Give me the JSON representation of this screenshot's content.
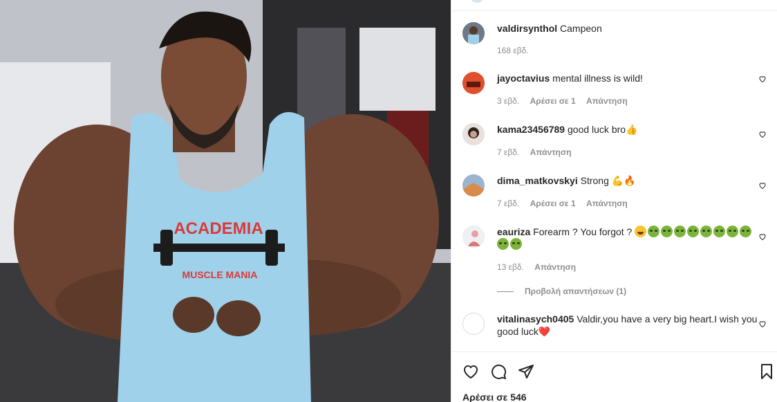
{
  "post": {
    "image_alt": "Bodybuilder with oversized arms wearing a light blue tank top",
    "shirt_text_top": "ACADEMIA",
    "shirt_text_bottom": "MUSCLE MANIA"
  },
  "caption": {
    "username": "valdirsynthol",
    "text": "Campeon",
    "time": "168 εβδ."
  },
  "comments": [
    {
      "username": "jayoctavius",
      "text": "mental illness is wild!",
      "time": "3 εβδ.",
      "likes": "Αρέσει σε 1",
      "reply": "Απάντηση"
    },
    {
      "username": "kama23456789",
      "text": "good luck bro👍",
      "time": "7 εβδ.",
      "reply": "Απάντηση"
    },
    {
      "username": "dima_matkovskyi",
      "text": "Strong 💪🔥",
      "time": "7 εβδ.",
      "likes": "Αρέσει σε 1",
      "reply": "Απάντηση"
    },
    {
      "username": "eauriza",
      "text": "Forearm ? You forgot ?",
      "time": "13 εβδ.",
      "reply": "Απάντηση"
    },
    {
      "username": "vitalinasych0405",
      "text": "Valdir,you have a very big heart.I wish you good luck❤️"
    }
  ],
  "view_replies": "Προβολή απαντήσεων (1)",
  "likes_total": "Αρέσει σε 546",
  "icons": {
    "like": "heart-icon",
    "comment": "comment-bubble-icon",
    "share": "paper-plane-icon",
    "save": "bookmark-icon"
  },
  "colors": {
    "accent": "#ed4956",
    "muted": "#8e8e8e",
    "text": "#262626",
    "border": "#efefef"
  }
}
